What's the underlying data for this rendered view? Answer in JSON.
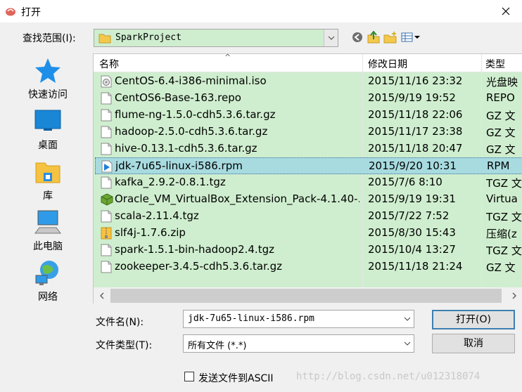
{
  "window": {
    "title": "打开"
  },
  "lookin": {
    "label": "查找范围(I):",
    "value": "SparkProject"
  },
  "toolbar": {
    "icons": [
      "back-icon",
      "up-folder-icon",
      "new-folder-icon",
      "view-menu-icon"
    ]
  },
  "places": [
    {
      "label": "快速访问",
      "icon": "star-icon"
    },
    {
      "label": "桌面",
      "icon": "desktop-icon"
    },
    {
      "label": "库",
      "icon": "library-icon"
    },
    {
      "label": "此电脑",
      "icon": "computer-icon"
    },
    {
      "label": "网络",
      "icon": "network-icon"
    }
  ],
  "columns": {
    "name": "名称",
    "modified": "修改日期",
    "type": "类型"
  },
  "files": [
    {
      "name": "CentOS-6.4-i386-minimal.iso",
      "date": "2015/11/16 23:32",
      "type": "光盘映",
      "icon": "disc-image-icon"
    },
    {
      "name": "CentOS6-Base-163.repo",
      "date": "2015/9/19 19:52",
      "type": "REPO",
      "icon": "file-icon"
    },
    {
      "name": "flume-ng-1.5.0-cdh5.3.6.tar.gz",
      "date": "2015/11/18 22:06",
      "type": "GZ 文",
      "icon": "file-icon"
    },
    {
      "name": "hadoop-2.5.0-cdh5.3.6.tar.gz",
      "date": "2015/11/17 23:38",
      "type": "GZ 文",
      "icon": "file-icon"
    },
    {
      "name": "hive-0.13.1-cdh5.3.6.tar.gz",
      "date": "2015/11/18 20:47",
      "type": "GZ 文",
      "icon": "file-icon"
    },
    {
      "name": "jdk-7u65-linux-i586.rpm",
      "date": "2015/9/20 10:31",
      "type": "RPM",
      "icon": "rpm-file-icon",
      "selected": true
    },
    {
      "name": "kafka_2.9.2-0.8.1.tgz",
      "date": "2015/7/6 8:10",
      "type": "TGZ 文",
      "icon": "file-icon"
    },
    {
      "name": "Oracle_VM_VirtualBox_Extension_Pack-4.1.40-...",
      "date": "2015/9/19 19:31",
      "type": "Virtua",
      "icon": "virtualbox-icon"
    },
    {
      "name": "scala-2.11.4.tgz",
      "date": "2015/7/22 7:52",
      "type": "TGZ 文",
      "icon": "file-icon"
    },
    {
      "name": "slf4j-1.7.6.zip",
      "date": "2015/8/30 15:43",
      "type": "压缩(z",
      "icon": "zip-icon"
    },
    {
      "name": "spark-1.5.1-bin-hadoop2.4.tgz",
      "date": "2015/10/4 13:27",
      "type": "TGZ 文",
      "icon": "file-icon"
    },
    {
      "name": "zookeeper-3.4.5-cdh5.3.6.tar.gz",
      "date": "2015/11/18 21:24",
      "type": "GZ 文",
      "icon": "file-icon"
    }
  ],
  "filename": {
    "label": "文件名(N):",
    "value": "jdk-7u65-linux-i586.rpm"
  },
  "filetype": {
    "label": "文件类型(T):",
    "value": "所有文件 (*.*)"
  },
  "buttons": {
    "open": "打开(O)",
    "cancel": "取消"
  },
  "ascii": {
    "label": "发送文件到ASCII",
    "checked": false
  },
  "watermark": "http://blog.csdn.net/u012318074"
}
